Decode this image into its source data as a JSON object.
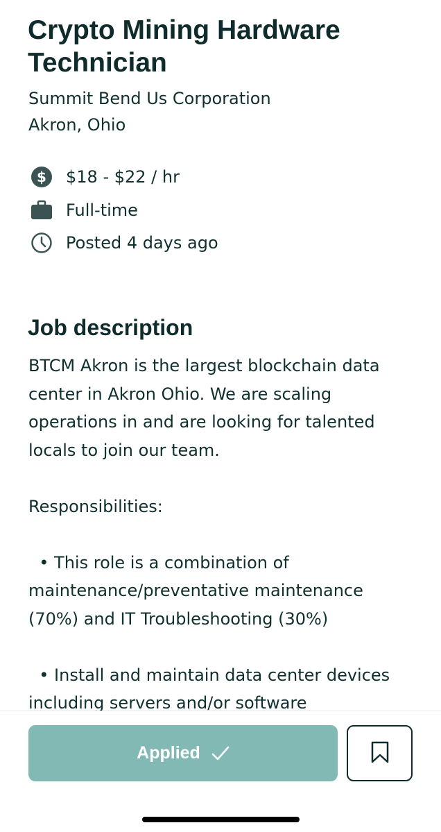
{
  "job": {
    "title": "Crypto Mining Hardware Technician",
    "company": "Summit Bend Us Corporation",
    "location": "Akron, Ohio"
  },
  "meta": {
    "pay": "$18 - $22 / hr",
    "pay_icon": "dollar-circle-icon",
    "type": "Full-time",
    "type_icon": "briefcase-icon",
    "posted": "Posted 4 days ago",
    "posted_icon": "clock-icon"
  },
  "description": {
    "heading": "Job description",
    "body": "BTCM Akron is the largest blockchain data center in Akron Ohio. We are scaling operations in and are looking for talented locals to join our team.\n\nResponsibilities:\n\n  • This role is a combination of maintenance/preventative maintenance (70%) and IT Troubleshooting (30%)\n\n  • Install and maintain data center devices including servers and/or software"
  },
  "actions": {
    "applied_label": "Applied",
    "applied_icon": "checkmark-icon",
    "save_icon": "bookmark-icon"
  },
  "colors": {
    "text": "#0f2b2b",
    "applied_bg": "#82b9b5",
    "icon": "#3b5352"
  }
}
